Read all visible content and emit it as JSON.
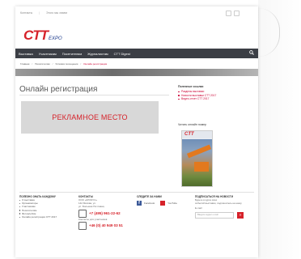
{
  "topbar": {
    "items": [
      "Контакты",
      "Этого мы знаем"
    ]
  },
  "logo": {
    "main": "CTT",
    "sub": "EXPO"
  },
  "nav": {
    "items": [
      "Выставка",
      "Участникам",
      "Посетителям",
      "Журналистам",
      "CTT Digest"
    ]
  },
  "breadcrumbs": {
    "items": [
      "Главная",
      "Посетителям",
      "Условия посещения",
      "Онлайн регистрация"
    ]
  },
  "page": {
    "title": "Онлайн регистрация"
  },
  "ad": {
    "text": "РЕКЛАМНОЕ МЕСТО"
  },
  "sidebar": {
    "title": "Полезные ссылки",
    "links": [
      "Разделы выставки",
      "Новости выставки CTT 2017",
      "Видео-отчет CTT 2017"
    ],
    "magazine_title": "Читать онлайн номер",
    "magazine_logo": "CTT"
  },
  "footer": {
    "col1": {
      "title": "ПОЛЕЗНО ЗНАТЬ КАЖДОМУ",
      "items": [
        "О выставке",
        "Организаторы",
        "Участникам",
        "Посетителям",
        "Фотоальбом",
        "Онлайн регистрация CTT 2017"
      ]
    },
    "col2": {
      "title": "КОНТАКТЫ",
      "lines": [
        "ООО «КРОКУС»",
        "142 Москва, ул.",
        "ул. Большая Почтовая,"
      ],
      "phone1": "+7 (495) 961-22-62",
      "subline": "Контакты для участников",
      "phone2": "+46 (0) 40 949 03 51"
    },
    "col3": {
      "title": "СЛЕДИТЕ ЗА НАМИ",
      "facebook": "Facebook",
      "youtube": "YouTube"
    },
    "col4": {
      "title": "ПОДПИСАТЬСЯ НА НОВОСТИ",
      "lines": [
        "Будьте в курсе всех",
        "событий выставки, подпишитесь на нашу"
      ],
      "email_label": "E-mail",
      "placeholder": "Введите адрес e-mail",
      "button": "»"
    }
  }
}
